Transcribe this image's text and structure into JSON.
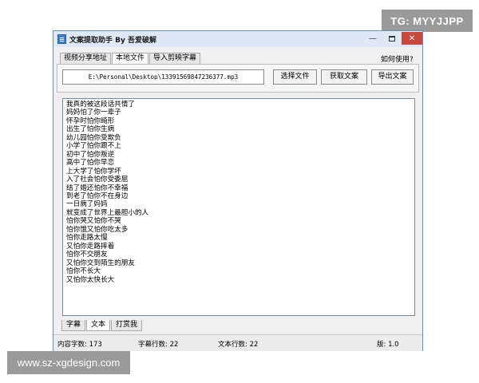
{
  "watermarks": {
    "top": "TG: MYYJJPP",
    "bottom": "www.sz-xgdesign.com"
  },
  "window": {
    "title": "文案提取助手 By 吾爱破解",
    "minimize": "—",
    "close": "✕"
  },
  "top_tabs": [
    "视频分享地址",
    "本地文件",
    "导入剪映字幕"
  ],
  "help_link": "如何使用?",
  "file": {
    "path": "E:\\Personal\\Desktop\\13391569847236377.mp3",
    "select_label": "选择文件",
    "get_label": "获取文案",
    "export_label": "导出文案"
  },
  "content_lines": [
    "我真的被这段话共情了",
    "妈妈怕了你一辈子",
    "怀孕时怕你畸形",
    "出生了怕你生病",
    "幼儿园怕你受欺负",
    "小学了怕你跟不上",
    "初中了怕你叛逆",
    "高中了怕你早恋",
    "上大学了怕你学坏",
    "入了社会怕你受委屈",
    "结了婚还怕你不幸福",
    "到老了怕你不在身边",
    "一日病了妈妈",
    "就变成了世界上最胆小的人",
    "怕你哭又怕你不哭",
    "怕你饿又怕你吃太多",
    "怕你走路太慢",
    "又怕你走路摔着",
    "怕你不交朋友",
    "又怕你交到陌生的朋友",
    "怕你不长大",
    "又怕你太快长大"
  ],
  "bottom_tabs": [
    "字幕",
    "文本",
    "打赏我"
  ],
  "status": {
    "chars": "内容字数: 173",
    "subtitle_lines": "字幕行数: 22",
    "text_lines": "文本行数: 22",
    "version": "版: 1.0"
  }
}
